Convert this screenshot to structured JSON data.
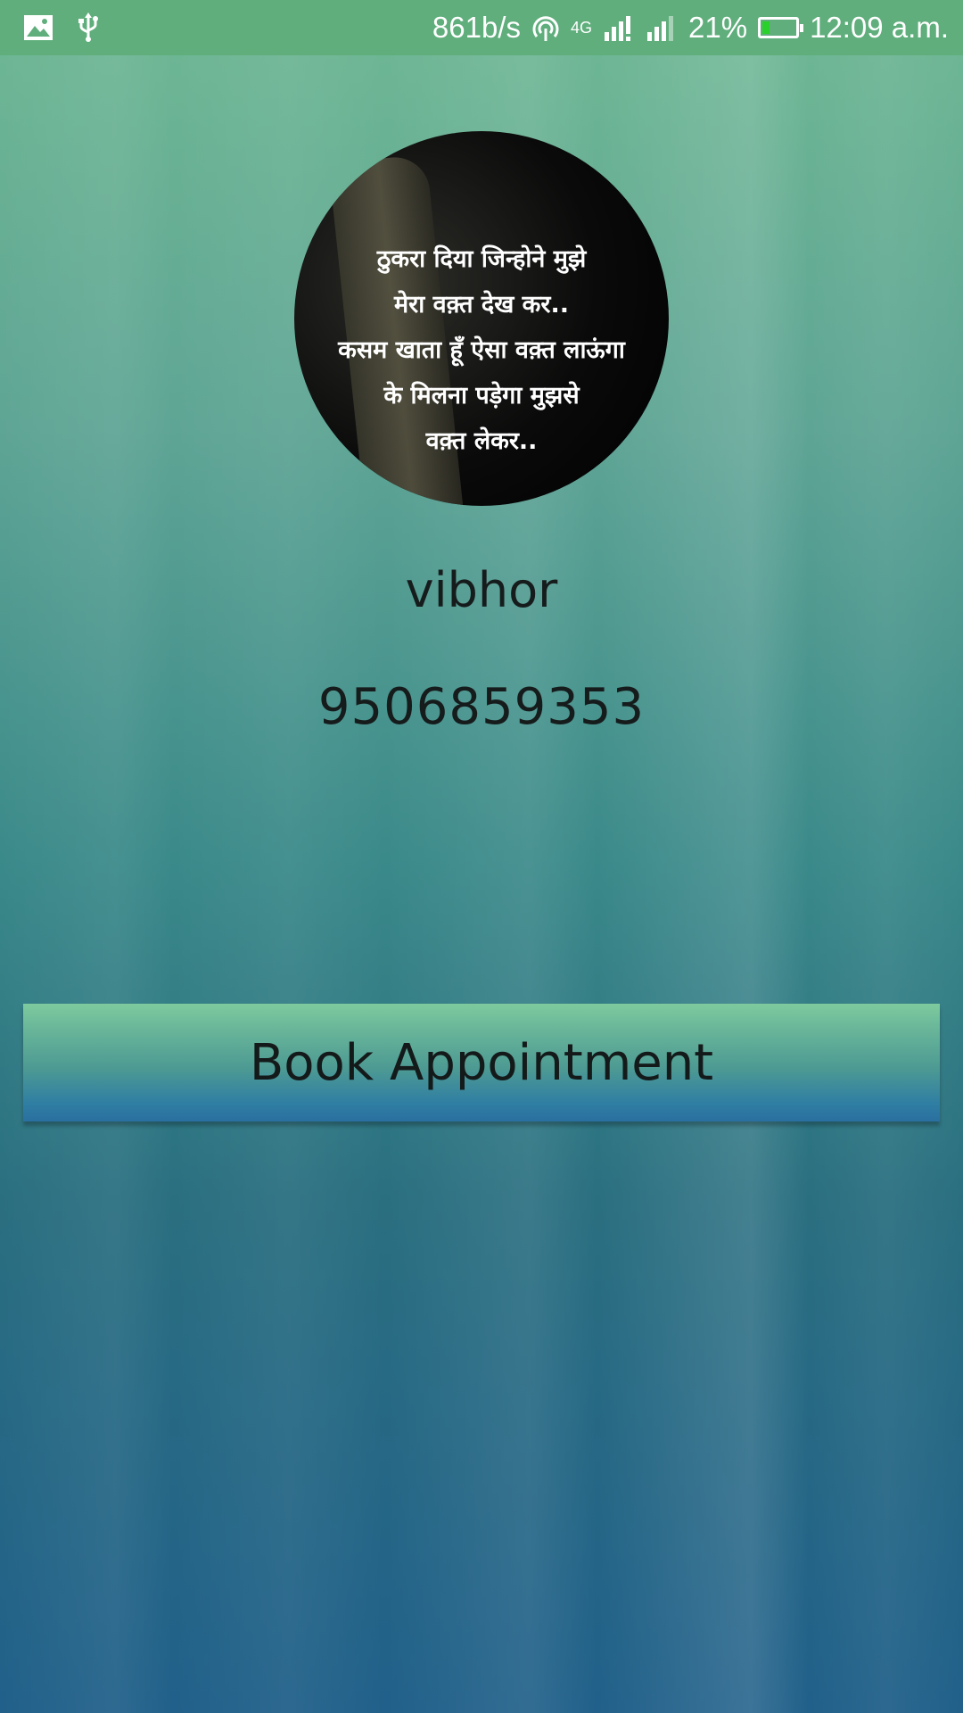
{
  "status_bar": {
    "network_speed": "861b/s",
    "network_type": "4G",
    "battery_percent": "21%",
    "battery_level": 0.21,
    "time": "12:09 a.m.",
    "icons": [
      "image-icon",
      "usb-icon",
      "hotspot-icon",
      "signal-icon",
      "signal-icon-2",
      "battery-icon"
    ]
  },
  "profile": {
    "avatar_quote_lines": [
      "ठुकरा दिया जिन्होने मुझे",
      "मेरा वक़्त देख कर..",
      "कसम खाता हूँ ऐसा वक़्त लाऊंगा",
      "के मिलना पड़ेगा मुझसे",
      "वक़्त लेकर.."
    ],
    "name": "vibhor",
    "phone": "9506859353"
  },
  "actions": {
    "book_label": "Book Appointment"
  }
}
